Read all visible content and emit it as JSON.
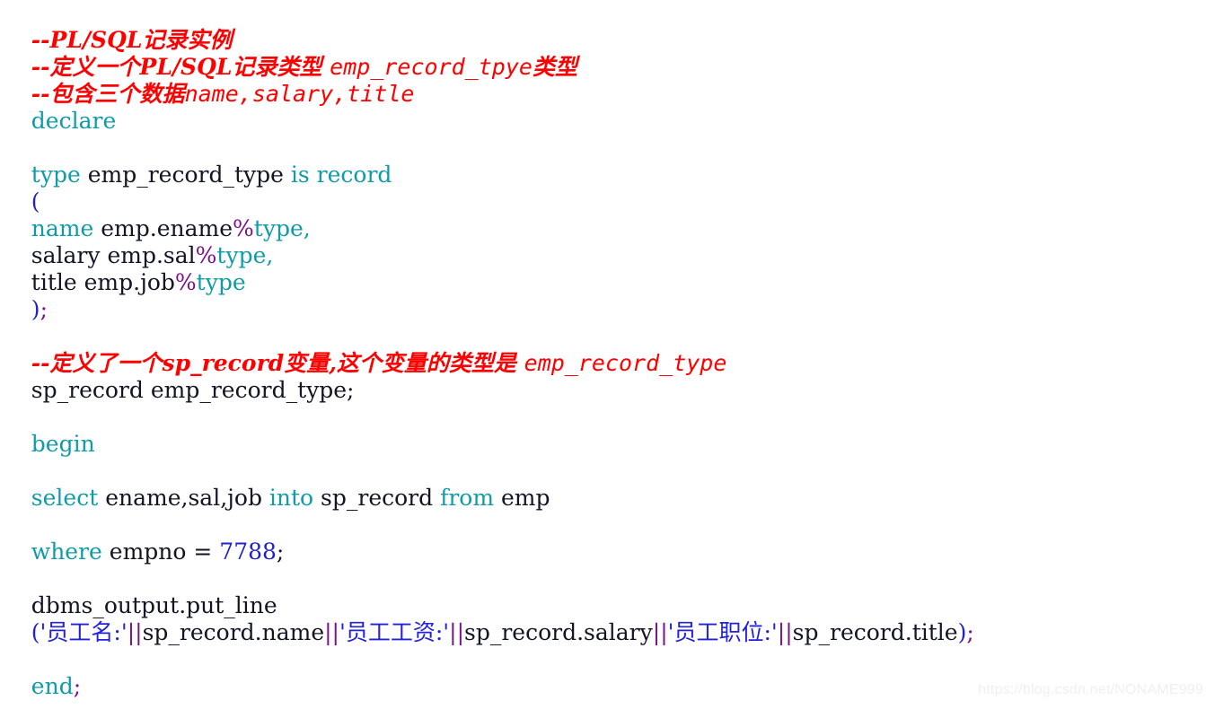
{
  "document": {
    "language": "PL/SQL",
    "background_color": "#ffffff",
    "colors": {
      "comment": "#ff0000",
      "keyword": "#0f9ba8",
      "identifier": "#141424",
      "number": "#2222cc",
      "string": "#2222dd",
      "operator": "#7b0f8c",
      "punctuation": "#2222cc",
      "watermark": "#f0f0f0"
    }
  },
  "lines": [
    {
      "id": "l01",
      "type": "comment",
      "text": "--PL/SQL记录实例"
    },
    {
      "id": "l02",
      "type": "comment",
      "text_cn_a": "--定义一个PL/SQL记录类型 ",
      "text_mono": "emp_record_tpye",
      "text_cn_b": "类型"
    },
    {
      "id": "l03",
      "type": "comment",
      "text_cn_a": "--包含三个数据",
      "text_mono": "name,salary,title",
      "text_cn_b": ""
    },
    {
      "id": "l04",
      "type": "code",
      "kw": "declare"
    },
    {
      "id": "l05",
      "type": "blank",
      "text": ""
    },
    {
      "id": "l06",
      "type": "code",
      "kw1": "type",
      "id1": " emp_record_type ",
      "kw2": "is record"
    },
    {
      "id": "l07",
      "type": "code",
      "punc": "("
    },
    {
      "id": "l08",
      "type": "code",
      "kw1": "name",
      "id1": " emp.ename",
      "op": "%",
      "kw2": "type",
      "kw3": ","
    },
    {
      "id": "l09",
      "type": "code",
      "id1": "salary emp.sal",
      "op": "%",
      "kw2": "type",
      "kw3": ","
    },
    {
      "id": "l10",
      "type": "code",
      "id1": "title emp.job",
      "op": "%",
      "kw2": "type"
    },
    {
      "id": "l11",
      "type": "code",
      "punc": ")",
      "op": ";"
    },
    {
      "id": "l12",
      "type": "blank",
      "text": ""
    },
    {
      "id": "l13",
      "type": "comment",
      "text_cn_a": "--定义了一个sp_record变量,这个变量的类型是 ",
      "text_mono": "emp_record_type",
      "text_cn_b": ""
    },
    {
      "id": "l14",
      "type": "code",
      "id1": "sp_record emp_record_type;"
    },
    {
      "id": "l15",
      "type": "blank",
      "text": ""
    },
    {
      "id": "l16",
      "type": "code",
      "kw": "begin"
    },
    {
      "id": "l17",
      "type": "blank",
      "text": ""
    },
    {
      "id": "l18",
      "type": "code",
      "kw1": "select",
      "id1": " ename,sal,job ",
      "kw2": "into",
      "id2": " sp_record ",
      "kw3": "from",
      "id3": " emp"
    },
    {
      "id": "l19",
      "type": "blank",
      "text": ""
    },
    {
      "id": "l20",
      "type": "code",
      "kw1": "where",
      "id1": " empno = ",
      "num": "7788",
      "id2": ";"
    },
    {
      "id": "l21",
      "type": "blank",
      "text": ""
    },
    {
      "id": "l22",
      "type": "code",
      "id1": "dbms_output.put_line"
    },
    {
      "id": "l23",
      "type": "code",
      "str1": "('员工名:'",
      "op1": "||",
      "id1": "sp_record.name",
      "op2": "||",
      "str2": "'员工工资:'",
      "op3": "||",
      "id2": "sp_record.salary",
      "op4": "||",
      "str3": "'员工职位:'",
      "op5": "||",
      "id3": "sp_record.title",
      "punc": ")",
      "op6": ";"
    },
    {
      "id": "l24",
      "type": "blank",
      "text": ""
    },
    {
      "id": "l25",
      "type": "code",
      "kw": "end",
      "op": ";"
    }
  ],
  "watermark": {
    "text": "https://blog.csdn.net/NONAME999"
  }
}
